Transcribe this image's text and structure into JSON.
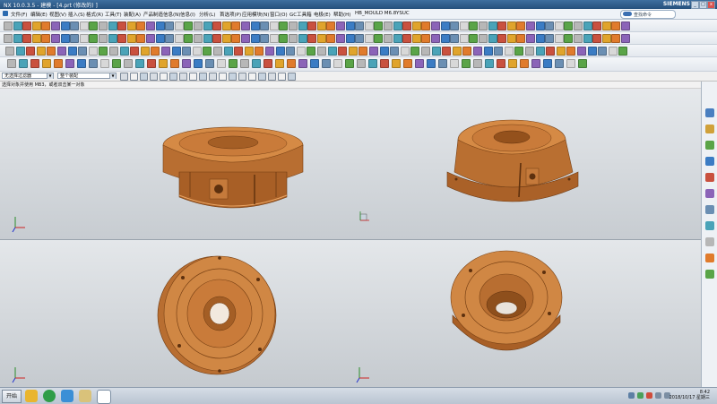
{
  "window": {
    "title": "NX 10.0.3.5 - 建模 - [4.prt (修改的) ]",
    "brand": "SIEMENS",
    "min_label": "_",
    "max_label": "□",
    "close_label": "x"
  },
  "menubar": {
    "items": [
      "文件(F)",
      "编辑(E)",
      "视图(V)",
      "插入(S)",
      "格式(R)",
      "工具(T)",
      "装配(A)",
      "产品制造信息(N)",
      "信息(I)",
      "分析(L)",
      "首选项(P)",
      "应用模块(N)",
      "窗口(O)",
      "GC工具箱",
      "电极(E)",
      "帮助(H)",
      "HB_MOULD M6.8",
      "YSUC"
    ],
    "find_command": "查找命令"
  },
  "selection_bar": {
    "filter_value": "无选择过滤器",
    "scope_value": "整个装配"
  },
  "cue_line": "选择对象并使用 MB3，或者双击某一对象",
  "taskbar": {
    "start_label": "开始",
    "clock_time": "8:42",
    "clock_date": "2018/10/17 星期三"
  },
  "colors": {
    "part": "#c97b3a",
    "part_dark": "#8e4f1c",
    "part_light": "#e39a57",
    "titlebar": "#2f5d8c"
  },
  "icons": {
    "views": [
      "trimetric-view",
      "isometric-view",
      "top-view",
      "bottom-view"
    ],
    "triad": "wcs-triad-icon"
  }
}
